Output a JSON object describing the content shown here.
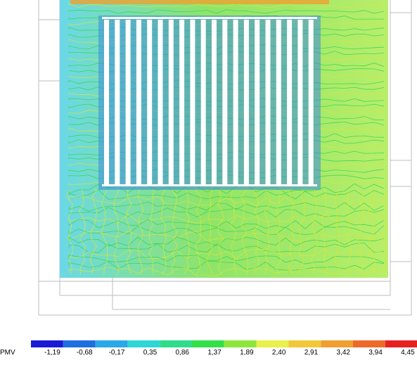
{
  "legend": {
    "label": "PMV",
    "ticks": [
      "-1,19",
      "-0,68",
      "-0,17",
      "0,35",
      "0,86",
      "1,37",
      "1,89",
      "2,40",
      "2,91",
      "3,42",
      "3,94",
      "4,45"
    ],
    "colors": [
      "#1a1ad6",
      "#1f6fe0",
      "#2aa8e8",
      "#2fd6d6",
      "#2edc8a",
      "#33e04a",
      "#8ee63a",
      "#e8f04a",
      "#f2c83a",
      "#f0a030",
      "#ee6a2a",
      "#e82020"
    ]
  },
  "palette": {
    "background": "#ffffff",
    "outline": "#bdbdbd",
    "plot_fill_left": "#6ad8e8",
    "plot_fill_mid": "#8fe46a",
    "plot_fill_right": "#b8ee6a",
    "contour_green": "#2fd64a",
    "contour_yellow": "#d8e83a",
    "stripe_white": "#ffffff",
    "stripe_blue": "#3a8ae0"
  }
}
